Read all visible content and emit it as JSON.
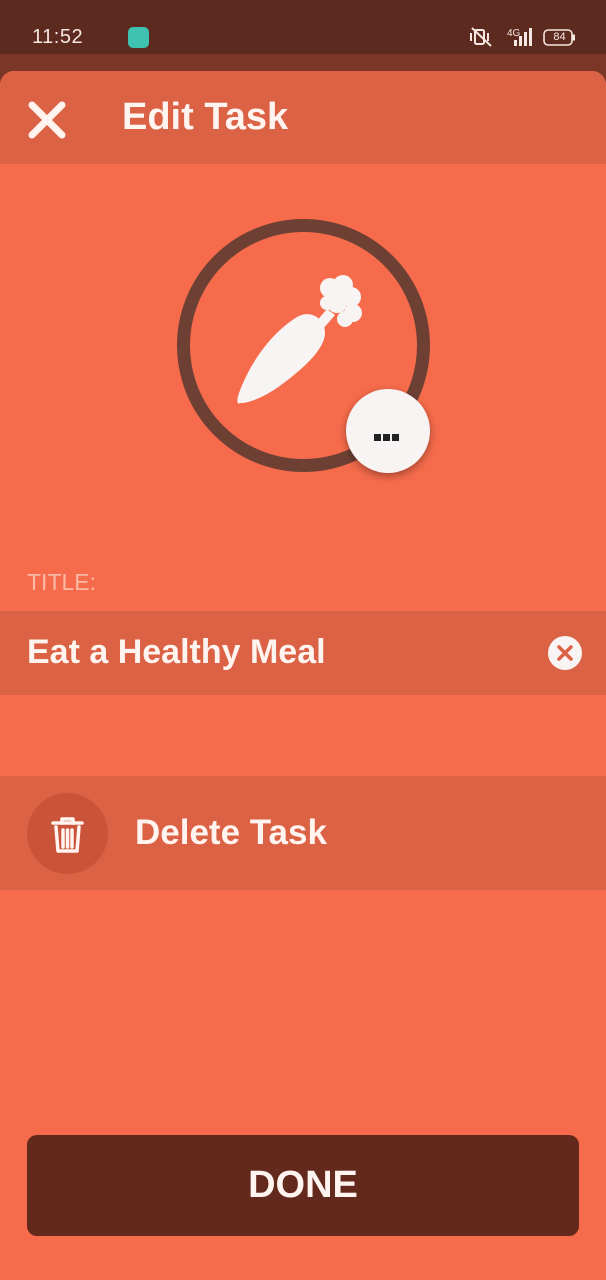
{
  "status_bar": {
    "time": "11:52",
    "network": "4G",
    "battery": "84",
    "icons": [
      "app-notification-icon",
      "vibrate-mute-icon",
      "signal-icon",
      "battery-icon"
    ]
  },
  "header": {
    "title": "Edit Task",
    "close_icon": "close-icon"
  },
  "task_icon": {
    "icon": "carrot-icon",
    "more_icon": "more-icon"
  },
  "title_section": {
    "label": "TITLE:",
    "value": "Eat a Healthy Meal",
    "clear_icon": "clear-icon"
  },
  "delete_action": {
    "label": "Delete Task",
    "icon": "trash-icon"
  },
  "done_button": {
    "label": "DONE"
  },
  "colors": {
    "background": "#f56b4b",
    "header": "#dc6245",
    "status_bar": "#5c2a1f",
    "ring": "#6e4034",
    "done_button": "#63291d",
    "text": "#fff4f0",
    "label": "#fbb9a6",
    "notification_app": "#3fc2b0"
  }
}
